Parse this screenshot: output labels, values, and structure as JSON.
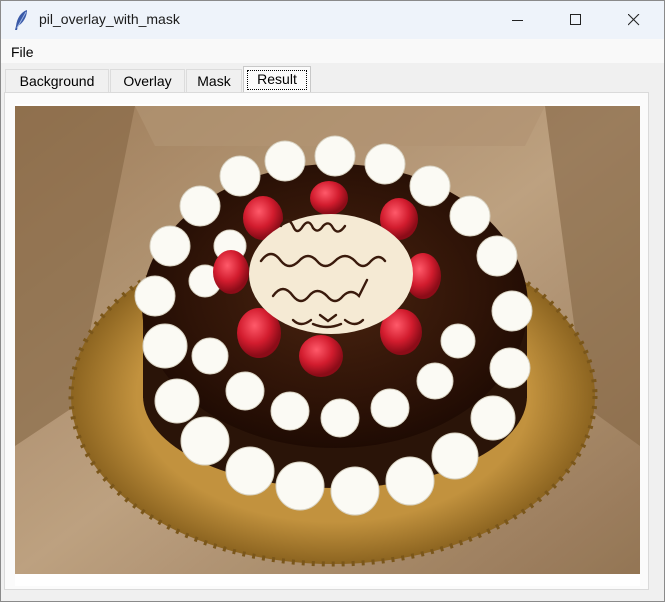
{
  "window": {
    "title": "pil_overlay_with_mask",
    "icon": "feather-icon"
  },
  "menu": {
    "file_label": "File"
  },
  "tabs": [
    {
      "label": "Background",
      "selected": false
    },
    {
      "label": "Overlay",
      "selected": false
    },
    {
      "label": "Mask",
      "selected": false
    },
    {
      "label": "Result",
      "selected": true
    }
  ],
  "result_image": {
    "cake_writing": [
      "Happy",
      "Homeownership",
      "Shaliny!"
    ]
  }
}
